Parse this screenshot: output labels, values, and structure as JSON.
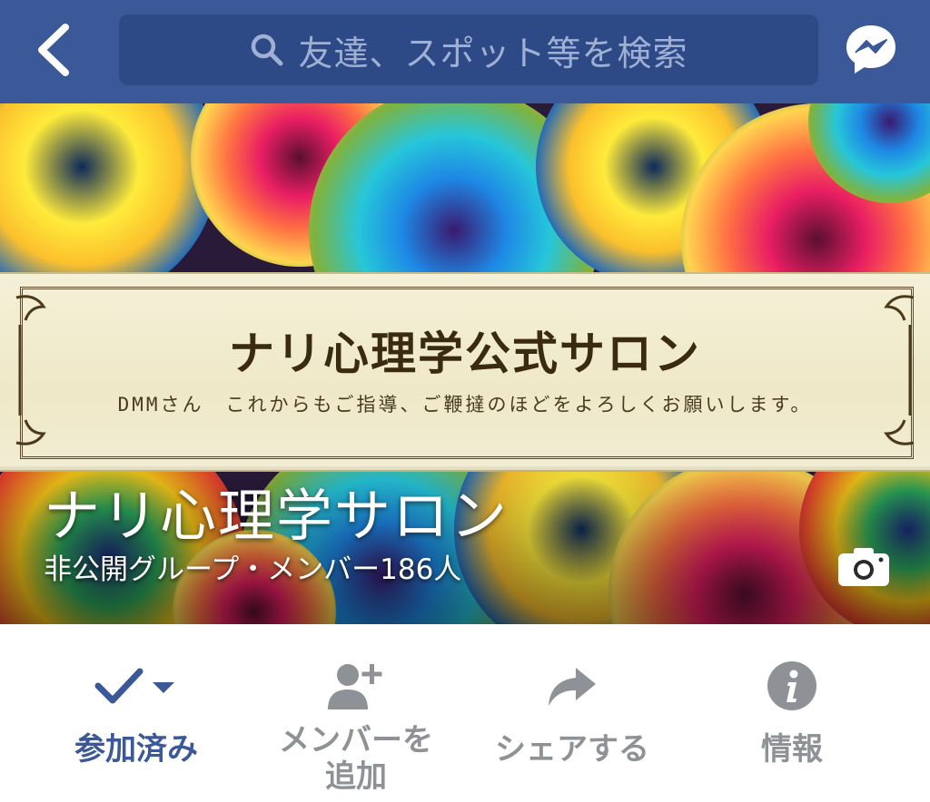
{
  "navbar": {
    "search_placeholder": "友達、スポット等を検索"
  },
  "cover": {
    "banner_title": "ナリ心理学公式サロン",
    "banner_subtitle": "DMMさん　これからもご指導、ご鞭撻のほどをよろしくお願いします。",
    "group_name": "ナリ心理学サロン",
    "group_meta": "非公開グループ・メンバー186人"
  },
  "actions": {
    "joined_label": "参加済み",
    "add_member_label": "メンバーを\n追加",
    "share_label": "シェアする",
    "info_label": "情報"
  },
  "colors": {
    "brand": "#3b5998",
    "search_field": "#2d4a87",
    "inactive_action": "#8e9196"
  }
}
